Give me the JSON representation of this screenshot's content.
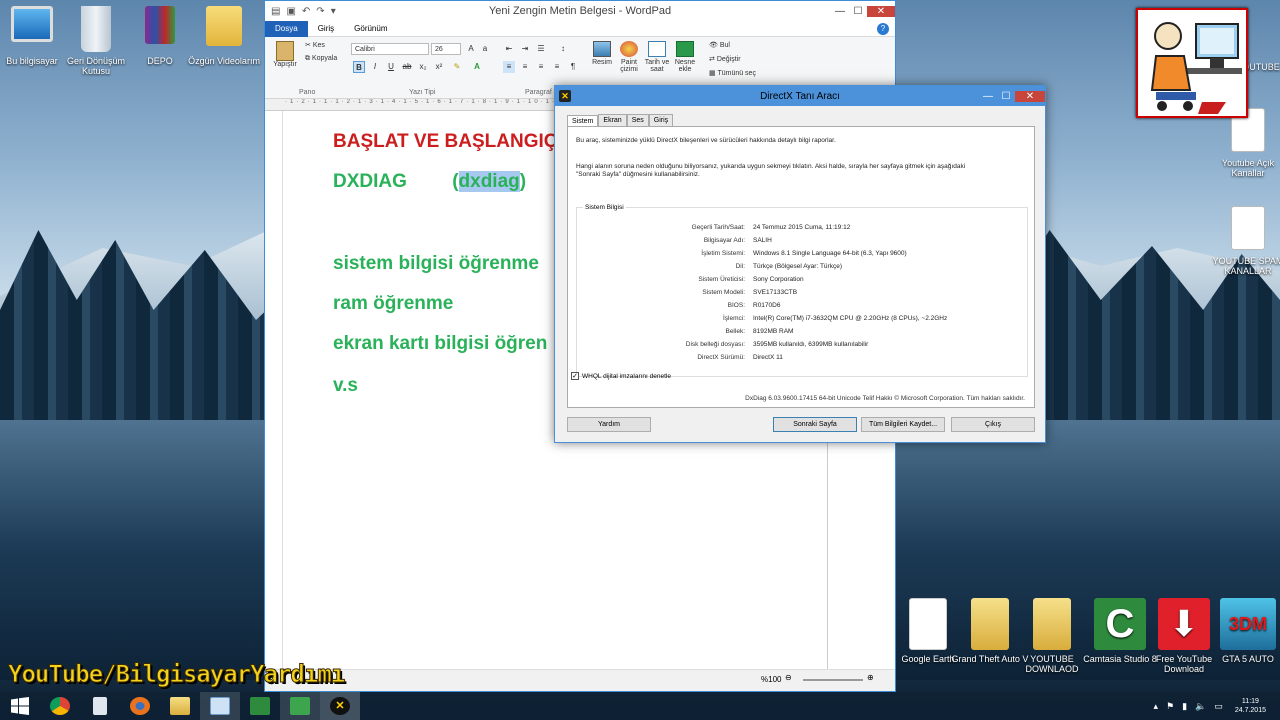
{
  "desktop": {
    "icons_left": [
      {
        "label": "Bu bilgisayar",
        "icon": "computer-icon"
      },
      {
        "label": "Geri Dönüşüm Kutusu",
        "icon": "recycle-bin-icon"
      },
      {
        "label": "DEPO",
        "icon": "winrar-icon"
      },
      {
        "label": "Özgün Videolarım",
        "icon": "folder-icon"
      }
    ],
    "icons_right": [
      {
        "label": "YOUTUBE",
        "icon": "folder-icon"
      },
      {
        "label": "Youtube Açık Kanallar",
        "icon": "document-icon"
      },
      {
        "label": "YOUTUBE SPAM KANALLAR",
        "icon": "document-icon"
      }
    ],
    "icons_bottom": [
      {
        "label": "Google Earth",
        "icon": "document-icon"
      },
      {
        "label": "Grand Theft Auto V",
        "icon": "folder-icon"
      },
      {
        "label": "YOUTUBE DOWNLAOD",
        "icon": "folder-icon"
      },
      {
        "label": "Camtasia Studio 8",
        "icon": "camtasia-icon"
      },
      {
        "label": "Free YouTube Download",
        "icon": "download-icon"
      },
      {
        "label": "GTA 5 AUTO",
        "icon": "3dm-icon"
      }
    ],
    "watermark": "YouTube/BilgisayarYardımı"
  },
  "wordpad": {
    "title": "Yeni Zengin Metin Belgesi - WordPad",
    "tabs": [
      "Dosya",
      "Giriş",
      "Görünüm"
    ],
    "ribbon": {
      "paste": "Yapıştır",
      "cut": "Kes",
      "copy": "Kopyala",
      "font_name": "Calibri",
      "font_size": "26",
      "group_clipboard": "Pano",
      "group_font": "Yazı Tipi",
      "group_paragraph": "Paragraf",
      "picture": "Resim",
      "paint": "Paint çizimi",
      "datetime": "Tarih ve saat",
      "object": "Nesne ekle",
      "find": "Bul",
      "replace": "Değiştir",
      "select_all": "Tümünü seç"
    },
    "doc": {
      "line1": "BAŞLAT VE BAŞLANGIÇ",
      "line2a": "DXDIAG",
      "line2b_open": "(",
      "line2b_sel": "dxdiag",
      "line2b_close": ")",
      "line3": "sistem bilgisi öğrenme",
      "line4": "ram öğrenme",
      "line5": "ekran kartı bilgisi öğren",
      "line6": "v.s"
    },
    "zoom": "%100"
  },
  "dxdiag": {
    "title": "DirectX Tanı Aracı",
    "tabs": [
      "Sistem",
      "Ekran",
      "Ses",
      "Giriş"
    ],
    "intro": "Bu araç, sisteminizde yüklü DirectX bileşenleri ve sürücüleri hakkında detaylı bilgi raporlar.",
    "hint1": "Hangi alanın soruna neden olduğunu biliyorsanız, yukarıda uygun sekmeyi tıklatın.  Aksi halde, sırayla her sayfaya gitmek için aşağıdaki",
    "hint2": "\"Sonraki Sayfa\" düğmesini kullanabilirsiniz.",
    "section": "Sistem Bilgisi",
    "info": [
      {
        "k": "Geçerli Tarih/Saat:",
        "v": "24 Temmuz 2015 Cuma, 11:19:12"
      },
      {
        "k": "Bilgisayar Adı:",
        "v": "SALIH"
      },
      {
        "k": "İşletim Sistemi:",
        "v": "Windows 8.1 Single Language 64-bit (6.3, Yapı 9600)"
      },
      {
        "k": "Dil:",
        "v": "Türkçe (Bölgesel Ayar: Türkçe)"
      },
      {
        "k": "Sistem Üreticisi:",
        "v": "Sony Corporation"
      },
      {
        "k": "Sistem Modeli:",
        "v": "SVE17133CTB"
      },
      {
        "k": "BIOS:",
        "v": "R0170D6"
      },
      {
        "k": "İşlemci:",
        "v": "Intel(R) Core(TM) i7-3632QM CPU @ 2.20GHz (8 CPUs), ~2.2GHz"
      },
      {
        "k": "Bellek:",
        "v": "8192MB RAM"
      },
      {
        "k": "Disk belleği dosyası:",
        "v": "3595MB kullanıldı, 6399MB kullanılabilir"
      },
      {
        "k": "DirectX Sürümü:",
        "v": "DirectX 11"
      }
    ],
    "whql": "WHQL dijital imzalarını denetle",
    "copyright": "DxDiag 6.03.9600.17415 64-bit Unicode  Telif Hakkı © Microsoft Corporation. Tüm hakları saklıdır.",
    "buttons": {
      "help": "Yardım",
      "next": "Sonraki Sayfa",
      "save": "Tüm Bilgileri Kaydet...",
      "exit": "Çıkış"
    }
  },
  "taskbar": {
    "time": "11:19",
    "date": "24.7.2015"
  }
}
